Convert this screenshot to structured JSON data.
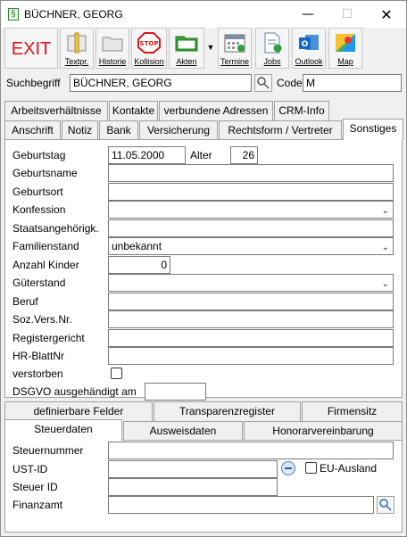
{
  "window": {
    "title": "BÜCHNER, GEORG",
    "app_icon": "§"
  },
  "toolbar": {
    "exit_label": "EXIT",
    "buttons": [
      {
        "label": "Textpr."
      },
      {
        "label": "Historie"
      },
      {
        "label": "Kollision"
      },
      {
        "label": "Akten"
      },
      {
        "label": "Termine"
      },
      {
        "label": "Jobs"
      },
      {
        "label": "Outlook"
      },
      {
        "label": "Map"
      }
    ]
  },
  "search": {
    "label": "Suchbegriff",
    "value": "BÜCHNER, GEORG",
    "code_label": "Code",
    "code_value": "M"
  },
  "tabs_row1": [
    "Arbeitsverhältnisse",
    "Kontakte",
    "verbundene Adressen",
    "CRM-Info"
  ],
  "tabs_row2": [
    "Anschrift",
    "Notiz",
    "Bank",
    "Versicherung",
    "Rechtsform / Vertreter",
    "Sonstiges"
  ],
  "active_tab": "Sonstiges",
  "form": {
    "geburtstag": {
      "label": "Geburtstag",
      "value": "11.05.2000",
      "alter_label": "Alter",
      "alter_value": "26"
    },
    "geburtsname": {
      "label": "Geburtsname",
      "value": ""
    },
    "geburtsort": {
      "label": "Geburtsort",
      "value": ""
    },
    "konfession": {
      "label": "Konfession",
      "value": ""
    },
    "staatsangehoerigkeit": {
      "label": "Staatsangehörigk.",
      "value": ""
    },
    "familienstand": {
      "label": "Familienstand",
      "value": "unbekannt"
    },
    "anzahl_kinder": {
      "label": "Anzahl Kinder",
      "value": "0"
    },
    "gueterstand": {
      "label": "Güterstand",
      "value": ""
    },
    "beruf": {
      "label": "Beruf",
      "value": ""
    },
    "sozvers": {
      "label": "Soz.Vers.Nr.",
      "value": ""
    },
    "registergericht": {
      "label": "Registergericht",
      "value": ""
    },
    "hrblatt": {
      "label": "HR-BlattNr",
      "value": ""
    },
    "verstorben": {
      "label": "verstorben",
      "checked": false
    },
    "dsgvo": {
      "label": "DSGVO ausgehändigt am",
      "value": ""
    }
  },
  "bottom_tabs_row1": [
    "definierbare Felder",
    "Transparenzregister",
    "Firmensitz"
  ],
  "bottom_tabs_row2": [
    "Steuerdaten",
    "Ausweisdaten",
    "Honorarvereinbarung"
  ],
  "bottom_active_tab": "Steuerdaten",
  "steuer": {
    "steuernummer": {
      "label": "Steuernummer",
      "value": ""
    },
    "ust_id": {
      "label": "UST-ID",
      "value": "",
      "eu_label": "EU-Ausland",
      "eu_checked": false
    },
    "steuer_id": {
      "label": "Steuer ID",
      "value": ""
    },
    "finanzamt": {
      "label": "Finanzamt",
      "value": ""
    }
  },
  "colors": {
    "exit": "#e0141e",
    "stop": "#d21a1a",
    "folder": "#3aa53a",
    "outlook": "#1468c8"
  }
}
